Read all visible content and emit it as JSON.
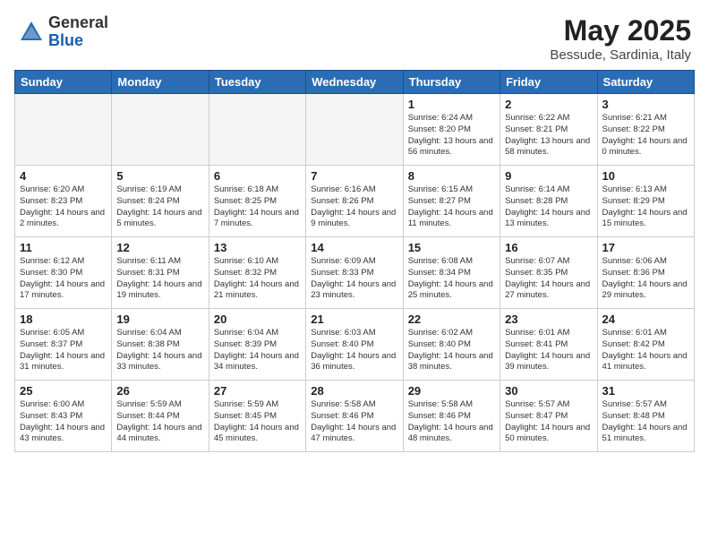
{
  "header": {
    "logo_general": "General",
    "logo_blue": "Blue",
    "month_title": "May 2025",
    "location": "Bessude, Sardinia, Italy"
  },
  "calendar": {
    "days_of_week": [
      "Sunday",
      "Monday",
      "Tuesday",
      "Wednesday",
      "Thursday",
      "Friday",
      "Saturday"
    ],
    "weeks": [
      [
        {
          "day": "",
          "empty": true
        },
        {
          "day": "",
          "empty": true
        },
        {
          "day": "",
          "empty": true
        },
        {
          "day": "",
          "empty": true
        },
        {
          "day": "1",
          "sunrise": "6:24 AM",
          "sunset": "8:20 PM",
          "daylight": "13 hours and 56 minutes."
        },
        {
          "day": "2",
          "sunrise": "6:22 AM",
          "sunset": "8:21 PM",
          "daylight": "13 hours and 58 minutes."
        },
        {
          "day": "3",
          "sunrise": "6:21 AM",
          "sunset": "8:22 PM",
          "daylight": "14 hours and 0 minutes."
        }
      ],
      [
        {
          "day": "4",
          "sunrise": "6:20 AM",
          "sunset": "8:23 PM",
          "daylight": "14 hours and 2 minutes."
        },
        {
          "day": "5",
          "sunrise": "6:19 AM",
          "sunset": "8:24 PM",
          "daylight": "14 hours and 5 minutes."
        },
        {
          "day": "6",
          "sunrise": "6:18 AM",
          "sunset": "8:25 PM",
          "daylight": "14 hours and 7 minutes."
        },
        {
          "day": "7",
          "sunrise": "6:16 AM",
          "sunset": "8:26 PM",
          "daylight": "14 hours and 9 minutes."
        },
        {
          "day": "8",
          "sunrise": "6:15 AM",
          "sunset": "8:27 PM",
          "daylight": "14 hours and 11 minutes."
        },
        {
          "day": "9",
          "sunrise": "6:14 AM",
          "sunset": "8:28 PM",
          "daylight": "14 hours and 13 minutes."
        },
        {
          "day": "10",
          "sunrise": "6:13 AM",
          "sunset": "8:29 PM",
          "daylight": "14 hours and 15 minutes."
        }
      ],
      [
        {
          "day": "11",
          "sunrise": "6:12 AM",
          "sunset": "8:30 PM",
          "daylight": "14 hours and 17 minutes."
        },
        {
          "day": "12",
          "sunrise": "6:11 AM",
          "sunset": "8:31 PM",
          "daylight": "14 hours and 19 minutes."
        },
        {
          "day": "13",
          "sunrise": "6:10 AM",
          "sunset": "8:32 PM",
          "daylight": "14 hours and 21 minutes."
        },
        {
          "day": "14",
          "sunrise": "6:09 AM",
          "sunset": "8:33 PM",
          "daylight": "14 hours and 23 minutes."
        },
        {
          "day": "15",
          "sunrise": "6:08 AM",
          "sunset": "8:34 PM",
          "daylight": "14 hours and 25 minutes."
        },
        {
          "day": "16",
          "sunrise": "6:07 AM",
          "sunset": "8:35 PM",
          "daylight": "14 hours and 27 minutes."
        },
        {
          "day": "17",
          "sunrise": "6:06 AM",
          "sunset": "8:36 PM",
          "daylight": "14 hours and 29 minutes."
        }
      ],
      [
        {
          "day": "18",
          "sunrise": "6:05 AM",
          "sunset": "8:37 PM",
          "daylight": "14 hours and 31 minutes."
        },
        {
          "day": "19",
          "sunrise": "6:04 AM",
          "sunset": "8:38 PM",
          "daylight": "14 hours and 33 minutes."
        },
        {
          "day": "20",
          "sunrise": "6:04 AM",
          "sunset": "8:39 PM",
          "daylight": "14 hours and 34 minutes."
        },
        {
          "day": "21",
          "sunrise": "6:03 AM",
          "sunset": "8:40 PM",
          "daylight": "14 hours and 36 minutes."
        },
        {
          "day": "22",
          "sunrise": "6:02 AM",
          "sunset": "8:40 PM",
          "daylight": "14 hours and 38 minutes."
        },
        {
          "day": "23",
          "sunrise": "6:01 AM",
          "sunset": "8:41 PM",
          "daylight": "14 hours and 39 minutes."
        },
        {
          "day": "24",
          "sunrise": "6:01 AM",
          "sunset": "8:42 PM",
          "daylight": "14 hours and 41 minutes."
        }
      ],
      [
        {
          "day": "25",
          "sunrise": "6:00 AM",
          "sunset": "8:43 PM",
          "daylight": "14 hours and 43 minutes."
        },
        {
          "day": "26",
          "sunrise": "5:59 AM",
          "sunset": "8:44 PM",
          "daylight": "14 hours and 44 minutes."
        },
        {
          "day": "27",
          "sunrise": "5:59 AM",
          "sunset": "8:45 PM",
          "daylight": "14 hours and 45 minutes."
        },
        {
          "day": "28",
          "sunrise": "5:58 AM",
          "sunset": "8:46 PM",
          "daylight": "14 hours and 47 minutes."
        },
        {
          "day": "29",
          "sunrise": "5:58 AM",
          "sunset": "8:46 PM",
          "daylight": "14 hours and 48 minutes."
        },
        {
          "day": "30",
          "sunrise": "5:57 AM",
          "sunset": "8:47 PM",
          "daylight": "14 hours and 50 minutes."
        },
        {
          "day": "31",
          "sunrise": "5:57 AM",
          "sunset": "8:48 PM",
          "daylight": "14 hours and 51 minutes."
        }
      ]
    ]
  }
}
